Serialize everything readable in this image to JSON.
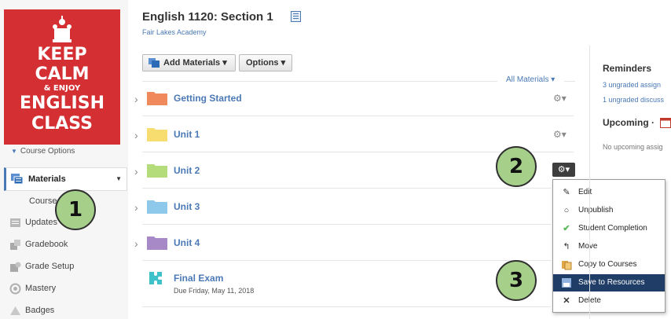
{
  "poster": {
    "line1": "KEEP",
    "line2": "CALM",
    "line3": "& ENJOY",
    "line4": "ENGLISH",
    "line5": "CLASS",
    "bg": "#d42f33"
  },
  "sidebar": {
    "course_options": "Course Options",
    "materials": "Materials",
    "sub": "Course",
    "items": [
      {
        "label": "Updates",
        "icon": "updates-icon"
      },
      {
        "label": "Gradebook",
        "icon": "gradebook-icon"
      },
      {
        "label": "Grade Setup",
        "icon": "grade-setup-icon"
      },
      {
        "label": "Mastery",
        "icon": "mastery-icon"
      },
      {
        "label": "Badges",
        "icon": "badges-icon"
      }
    ]
  },
  "callouts": {
    "one": "1",
    "two": "2",
    "three": "3",
    "color": "#a6cf8a"
  },
  "header": {
    "title": "English 1120: Section 1",
    "school": "Fair Lakes Academy"
  },
  "toolbar": {
    "add_materials": "Add Materials",
    "options": "Options",
    "all_materials": "All Materials"
  },
  "materials": [
    {
      "label": "Getting Started",
      "color": "#f08a5d"
    },
    {
      "label": "Unit 1",
      "color": "#f7dc6f"
    },
    {
      "label": "Unit 2",
      "color": "#b5dc7a"
    },
    {
      "label": "Unit 3",
      "color": "#8ec9ec"
    },
    {
      "label": "Unit 4",
      "color": "#a889c8"
    }
  ],
  "final_exam": {
    "label": "Final Exam",
    "due": "Due Friday, May 11, 2018"
  },
  "menu": {
    "items": [
      {
        "label": "Edit",
        "icon": "pencil-icon"
      },
      {
        "label": "Unpublish",
        "icon": "circle-icon"
      },
      {
        "label": "Student Completion",
        "icon": "checkmark-icon"
      },
      {
        "label": "Move",
        "icon": "move-arrow-icon"
      },
      {
        "label": "Copy to Courses",
        "icon": "copy-icon"
      },
      {
        "label": "Save to Resources",
        "icon": "save-resources-icon"
      },
      {
        "label": "Delete",
        "icon": "delete-x-icon"
      }
    ]
  },
  "right": {
    "reminders": "Reminders",
    "rem1": "3 ungraded assign",
    "rem2": "1 ungraded discuss",
    "upcoming": "Upcoming ·",
    "none": "No upcoming assig"
  }
}
